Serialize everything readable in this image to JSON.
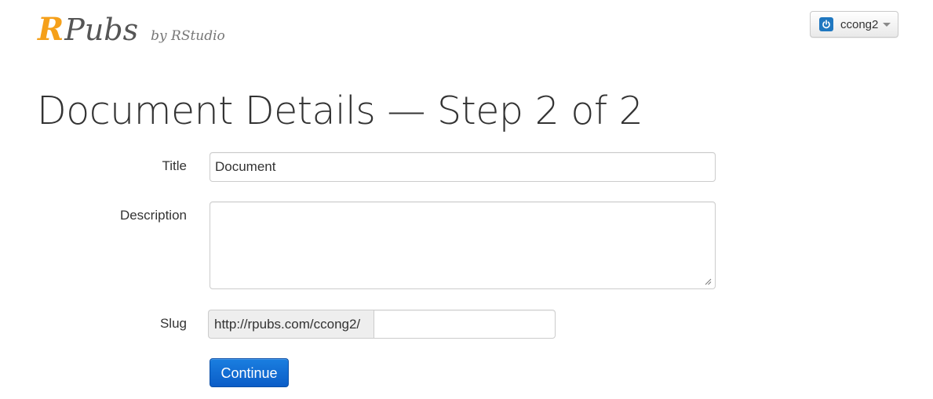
{
  "header": {
    "logo_r": "R",
    "logo_pubs": "Pubs",
    "logo_by": "by RStudio",
    "user_menu": {
      "username": "ccong2",
      "icon": "power-icon",
      "dropdown_icon": "caret-down-icon"
    }
  },
  "page": {
    "title": "Document Details — Step 2 of 2"
  },
  "form": {
    "title_label": "Title",
    "title_value": "Document",
    "description_label": "Description",
    "description_value": "",
    "slug_label": "Slug",
    "slug_prefix": "http://rpubs.com/ccong2/",
    "slug_value": "",
    "continue_label": "Continue"
  },
  "colors": {
    "brand_orange": "#f5a01a",
    "primary_button": "#0b5dc7",
    "power_icon": "#1f77c0"
  }
}
